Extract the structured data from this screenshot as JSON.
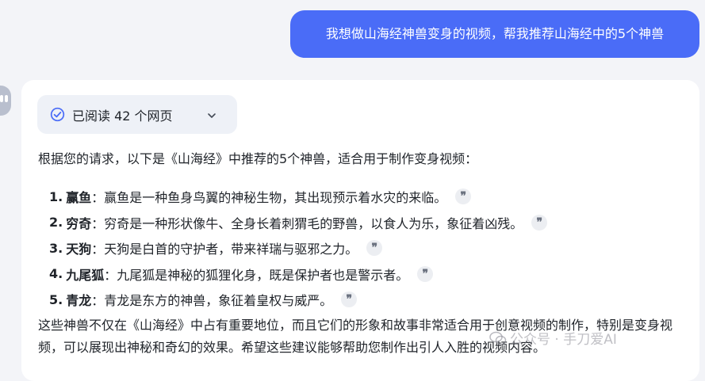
{
  "user_message": "我想做山海经神兽变身的视频，帮我推荐山海经中的5个神兽",
  "sources_pill": {
    "label": "已阅读 42 个网页",
    "icon": "check-circle-icon",
    "toggle_icon": "chevron-down-icon"
  },
  "intro": "根据您的请求，以下是《山海经》中推荐的5个神兽，适合用于制作变身视频：",
  "beasts": [
    {
      "num": "1.",
      "name": "赢鱼",
      "desc": "：赢鱼是一种鱼身鸟翼的神秘生物，其出现预示着水灾的来临。"
    },
    {
      "num": "2.",
      "name": "穷奇",
      "desc": "：穷奇是一种形状像牛、全身长着刺猬毛的野兽，以食人为乐，象征着凶残。"
    },
    {
      "num": "3.",
      "name": "天狗",
      "desc": "：天狗是白首的守护者，带来祥瑞与驱邪之力。"
    },
    {
      "num": "4.",
      "name": "九尾狐",
      "desc": "：九尾狐是神秘的狐狸化身，既是保护者也是警示者。"
    },
    {
      "num": "5.",
      "name": "青龙",
      "desc": "：青龙是东方的神兽，象征着皇权与威严。"
    }
  ],
  "quote_glyph": "❞",
  "summary": "这些神兽不仅在《山海经》中占有重要地位，而且它们的形象和故事非常适合用于创意视频的制作，特别是变身视频，可以展现出神秘和奇幻的效果。希望这些建议能够帮助您制作出引人入胜的视频内容。",
  "watermark": "公众号 · 手刀爱AI",
  "colors": {
    "accent": "#4a6cf7",
    "page_bg": "#f3f4f8",
    "pill_bg": "#eef1f7"
  }
}
